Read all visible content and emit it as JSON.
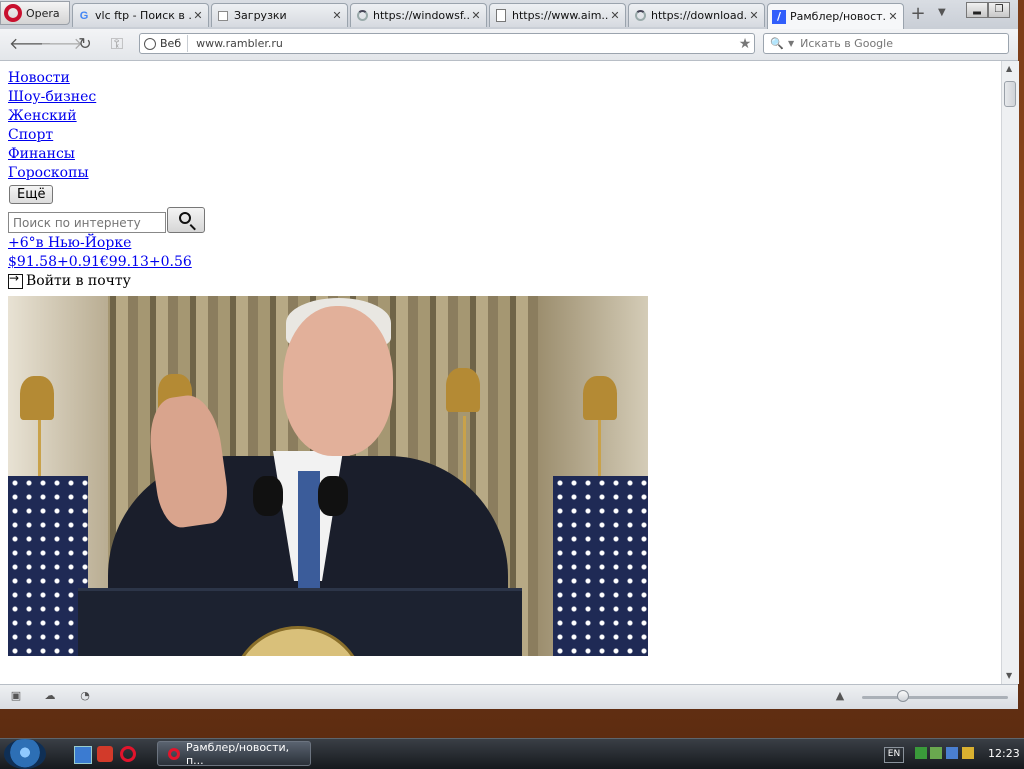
{
  "browser": {
    "menu_label": "Opera",
    "tabs": [
      {
        "title": "vlc ftp - Поиск в ...",
        "icon": "google-icon"
      },
      {
        "title": "Загрузки",
        "icon": "downloads-icon"
      },
      {
        "title": "https://windowsf...",
        "icon": "loading-icon"
      },
      {
        "title": "https://www.aim...",
        "icon": "page-icon"
      },
      {
        "title": "https://download...",
        "icon": "loading-icon"
      },
      {
        "title": "Рамблер/новост...",
        "icon": "rambler-icon"
      }
    ],
    "address": {
      "badge": "Веб",
      "url": "www.rambler.ru"
    },
    "search_placeholder": "Искать в Google"
  },
  "page": {
    "nav": [
      "Новости",
      "Шоу-бизнес",
      "Женский",
      "Спорт",
      "Финансы",
      "Гороскопы"
    ],
    "more_label": "Ещё",
    "search_placeholder": "Поиск по интернету",
    "weather": "+6°в Нью-Йорке",
    "rates": "$91.58+0.91€99.13+0.56",
    "login_label": "Войти в почту"
  },
  "taskbar": {
    "task_label": "Рамблер/новости, п...",
    "lang": "EN",
    "clock": "12:23"
  },
  "colors": {
    "link": "#0000ee",
    "opera_red": "#c8102e",
    "rambler_blue": "#315efb"
  }
}
